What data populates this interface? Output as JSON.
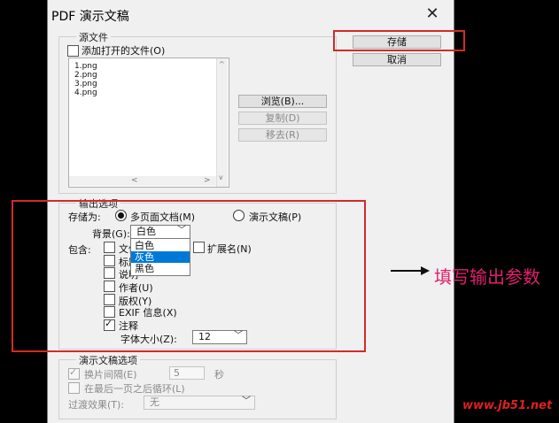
{
  "dialog": {
    "title": "PDF 演示文稿",
    "close_label": "✕"
  },
  "buttons": {
    "save": "存储",
    "cancel": "取消"
  },
  "source": {
    "legend": "源文件",
    "add_open_label": "添加打开的文件(O)",
    "files": [
      "1.png",
      "2.png",
      "3.png",
      "4.png"
    ],
    "browse": "浏览(B)...",
    "duplicate": "复制(D)",
    "remove": "移去(R)",
    "scroll_left": "<",
    "scroll_right": ">"
  },
  "output": {
    "legend": "输出选项",
    "save_as_label": "存储为:",
    "multi_page": "多页面文档(M)",
    "presentation": "演示文稿(P)",
    "background_label": "背景(G):",
    "background_value": "白色",
    "background_options": [
      "白色",
      "灰色",
      "黑色"
    ],
    "include_label": "包含:",
    "include_items": [
      {
        "label": "文件名",
        "checked": false
      },
      {
        "label": "标题",
        "checked": false
      },
      {
        "label": "说明",
        "checked": false
      },
      {
        "label": "作者(U)",
        "checked": false
      },
      {
        "label": "版权(Y)",
        "checked": false
      },
      {
        "label": "EXIF 信息(X)",
        "checked": false
      },
      {
        "label": "注释",
        "checked": true
      }
    ],
    "extension_label": "扩展名(N)",
    "font_size_label": "字体大小(Z):",
    "font_size_value": "12"
  },
  "presentation_options": {
    "legend": "演示文稿选项",
    "advance_label": "换片间隔(E)",
    "advance_value": "5",
    "seconds_label": "秒",
    "loop_label": "在最后一页之后循环(L)",
    "transition_label": "过渡效果(T):",
    "transition_value": "无"
  },
  "annotation": {
    "text": "填写输出参数",
    "watermark": "www.jb51.net"
  },
  "colors": {
    "highlight_red": "#d42a2a",
    "annotation_pink": "#e0206e",
    "selection_blue": "#0078d7"
  }
}
